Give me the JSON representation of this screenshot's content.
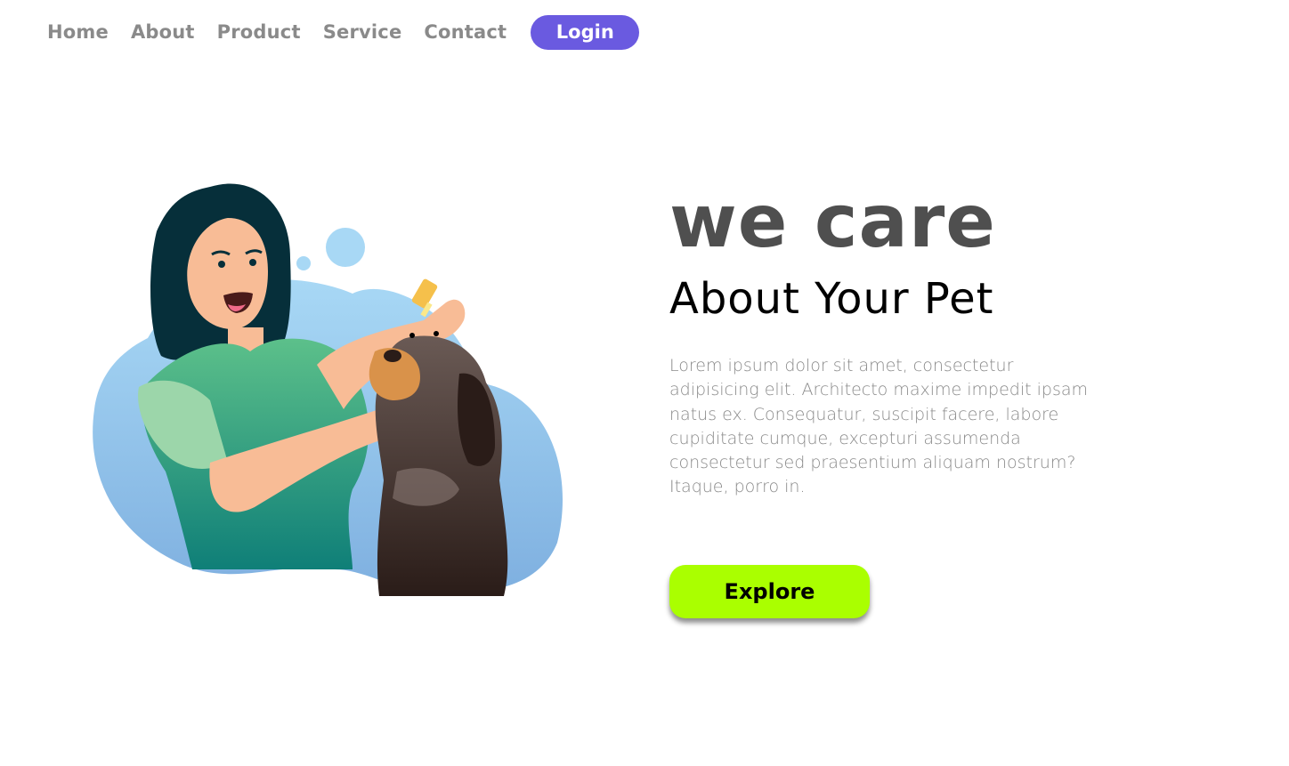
{
  "nav": {
    "items": [
      {
        "label": "Home"
      },
      {
        "label": "About"
      },
      {
        "label": "Product"
      },
      {
        "label": "Service"
      },
      {
        "label": "Contact"
      }
    ],
    "login_label": "Login"
  },
  "hero": {
    "title": "we care",
    "subtitle": "About Your Pet",
    "body": "Lorem ipsum dolor sit amet, consectetur adipisicing elit. Architecto maxime impedit ipsam natus ex. Consequatur, suscipit facere, labore cupiditate cumque, excepturi assumenda consectetur sed praesentium aliquam nostrum? Itaque, porro in.",
    "explore_label": "Explore"
  },
  "colors": {
    "accent": "#6a5ae0",
    "cta": "#aaff00",
    "nav_text": "#8a8a8a",
    "title_text": "#4f4f4f"
  },
  "illustration": {
    "icon": "woman-caring-for-dog-illustration"
  }
}
